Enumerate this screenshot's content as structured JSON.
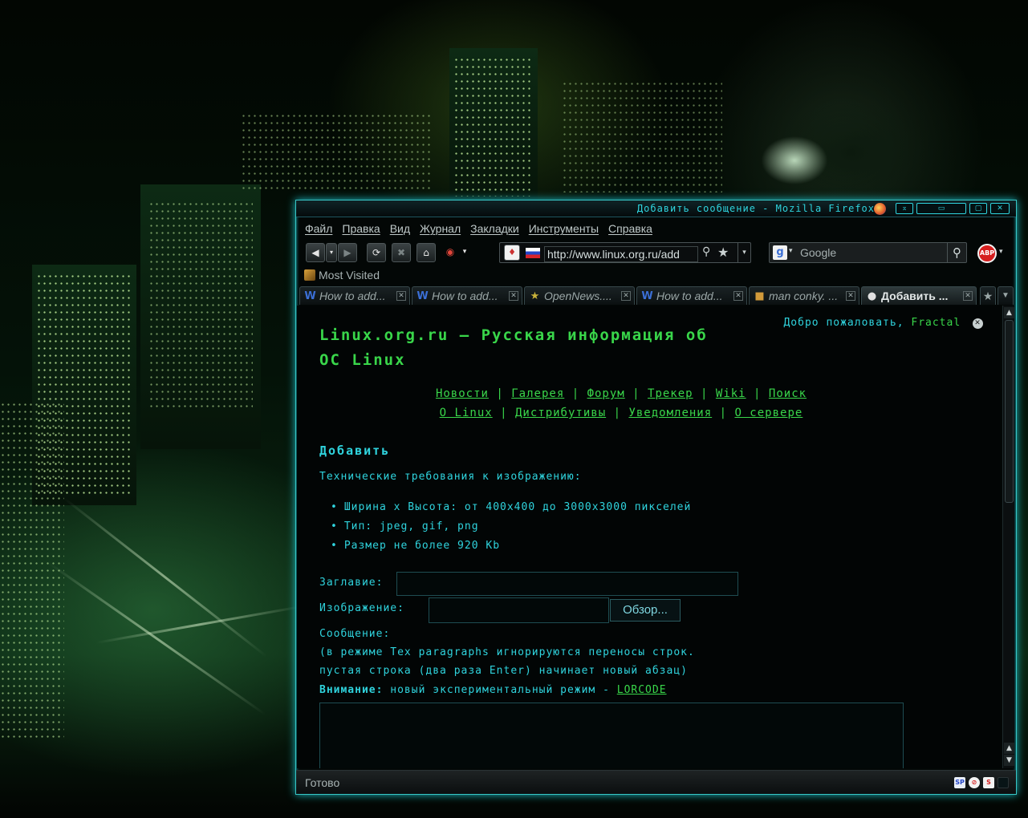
{
  "window": {
    "title": "Добавить сообщение - Mozilla Firefox"
  },
  "menu": [
    "Файл",
    "Правка",
    "Вид",
    "Журнал",
    "Закладки",
    "Инструменты",
    "Справка"
  ],
  "toolbar": {
    "url": "http://www.linux.org.ru/add",
    "search_placeholder": "Google"
  },
  "bookmarks": {
    "most_visited": "Most Visited"
  },
  "tabs": [
    {
      "label": "How to add...",
      "icon": "W",
      "icon_color": "#3b6fd6"
    },
    {
      "label": "How to add...",
      "icon": "W",
      "icon_color": "#3b6fd6"
    },
    {
      "label": "OpenNews....",
      "icon": "★",
      "icon_color": "#c9b23a"
    },
    {
      "label": "How to add...",
      "icon": "W",
      "icon_color": "#3b6fd6"
    },
    {
      "label": "man conky. ...",
      "icon": "■",
      "icon_color": "#d29a3a"
    },
    {
      "label": "Добавить ...",
      "icon": "●",
      "icon_color": "#e0e0e0",
      "active": true
    }
  ],
  "page": {
    "site_title": "Linux.org.ru — Русская информация об ОС Linux",
    "welcome_text": "Добро пожаловать,",
    "welcome_user": "Fractal",
    "nav_row1": [
      "Новости",
      "Галерея",
      "Форум",
      "Трекер",
      "Wiki",
      "Поиск"
    ],
    "nav_row2": [
      "О Linux",
      "Дистрибутивы",
      "Уведомления",
      "О сервере"
    ],
    "heading": "Добавить",
    "tech_requirements": "Технические требования к изображению:",
    "requirements": [
      "Ширина x Высота: от 400x400 до 3000x3000 пикселей",
      "Тип: jpeg, gif, png",
      "Размер не более 920 Kb"
    ],
    "label_title": "Заглавие:",
    "label_image": "Изображение:",
    "browse_button": "Обзор...",
    "label_message": "Сообщение:",
    "note_line1": "(в режиме Tex paragraphs игнорируются переносы строк.",
    "note_line2": "пустая строка (два раза Enter) начинает новый абзац)",
    "warning_label": "Внимание:",
    "warning_text": "новый экспериментальный режим -",
    "warning_link": "LORCODE"
  },
  "status": {
    "text": "Готово"
  }
}
